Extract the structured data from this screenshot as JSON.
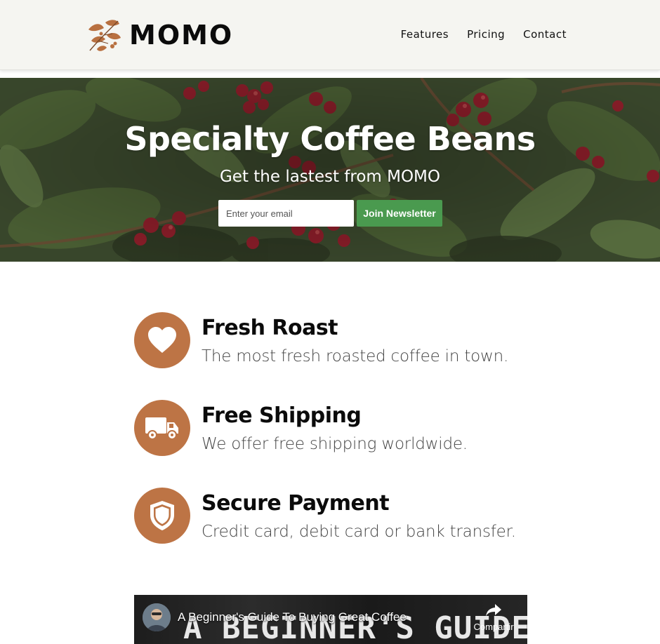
{
  "header": {
    "brand": "MOMO",
    "nav": [
      {
        "label": "Features"
      },
      {
        "label": "Pricing"
      },
      {
        "label": "Contact"
      }
    ]
  },
  "hero": {
    "title": "Specialty Coffee Beans",
    "subtitle": "Get the lastest from MOMO",
    "email_placeholder": "Enter your email",
    "button_label": "Join Newsletter"
  },
  "features": [
    {
      "icon": "heart-icon",
      "title": "Fresh Roast",
      "description": "The most fresh roasted coffee in town."
    },
    {
      "icon": "truck-icon",
      "title": "Free Shipping",
      "description": "We offer free shipping worldwide."
    },
    {
      "icon": "shield-icon",
      "title": "Secure Payment",
      "description": "Credit card, debit card or bank transfer."
    }
  ],
  "video": {
    "title": "A Beginner's Guide To Buying Great Coffee",
    "thumbnail_text": "A BEGINNER'S GUIDE TO",
    "share_label": "Compartir"
  },
  "colors": {
    "accent": "#bd7445",
    "button": "#4a9a4f",
    "header_bg": "#f5f5f1"
  }
}
